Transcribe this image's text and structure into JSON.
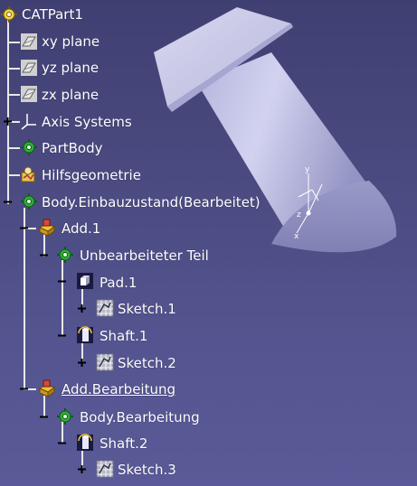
{
  "tree": {
    "root": {
      "label": "CATPart1",
      "icon": "part-gear-icon"
    },
    "nodes": [
      {
        "label": "xy plane",
        "icon": "plane-icon"
      },
      {
        "label": "yz plane",
        "icon": "plane-icon"
      },
      {
        "label": "zx plane",
        "icon": "plane-icon"
      },
      {
        "label": "Axis Systems",
        "icon": "axis-system-icon",
        "expander": "+"
      },
      {
        "label": "PartBody",
        "icon": "body-gear-icon"
      },
      {
        "label": "Hilfsgeometrie",
        "icon": "geometrical-set-icon"
      },
      {
        "label": "Body.Einbauzustand(Bearbeitet)",
        "icon": "body-gear-icon",
        "expander": "-"
      },
      {
        "label": "Add.1",
        "icon": "boolean-add-icon",
        "expander": "-"
      },
      {
        "label": "Unbearbeiteter Teil",
        "icon": "body-gear-icon",
        "expander": "-"
      },
      {
        "label": "Pad.1",
        "icon": "pad-icon",
        "expander": "-"
      },
      {
        "label": "Sketch.1",
        "icon": "sketch-icon",
        "expander": "+"
      },
      {
        "label": "Shaft.1",
        "icon": "shaft-icon",
        "expander": "-"
      },
      {
        "label": "Sketch.2",
        "icon": "sketch-icon",
        "expander": "+"
      },
      {
        "label": "Add.Bearbeitung",
        "icon": "boolean-add-icon",
        "expander": "-",
        "selected": true
      },
      {
        "label": "Body.Bearbeitung",
        "icon": "body-gear-icon",
        "expander": "-"
      },
      {
        "label": "Shaft.2",
        "icon": "shaft-icon",
        "expander": "-"
      },
      {
        "label": "Sketch.3",
        "icon": "sketch-icon",
        "expander": "+"
      }
    ]
  },
  "compass": {
    "x_label": "x",
    "y_label": "y",
    "z_label": "z"
  },
  "colors": {
    "background_top": "#3f3f72",
    "background_bottom": "#5a5a98",
    "model_face": "#c8c8e8",
    "model_shadow": "#8c8cc0",
    "tree_text": "#ffffff",
    "gear_green": "#2fae3a"
  }
}
